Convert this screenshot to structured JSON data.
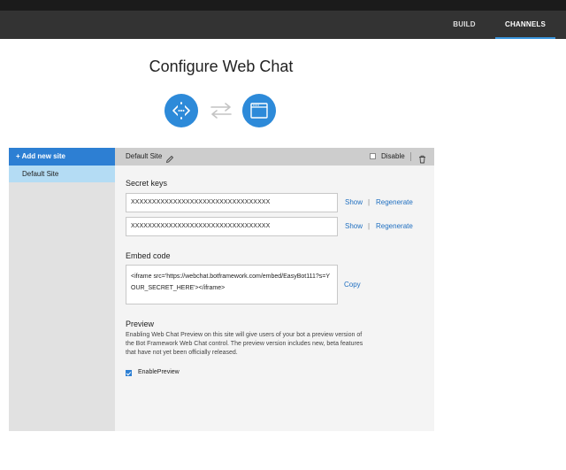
{
  "nav": {
    "build_label": "BUILD",
    "channels_label": "CHANNELS"
  },
  "page": {
    "title": "Configure Web Chat"
  },
  "icons": {
    "left": "code-brackets-icon",
    "middle": "swap-arrows-icon",
    "right": "browser-window-icon"
  },
  "sidebar": {
    "add_label": "+ Add new site",
    "items": [
      {
        "label": "Default Site",
        "selected": true
      }
    ]
  },
  "panel": {
    "site_name": "Default Site",
    "disable_label": "Disable",
    "disable_checked": false,
    "secret_keys_title": "Secret keys",
    "keys": [
      {
        "value": "XXXXXXXXXXXXXXXXXXXXXXXXXXXXXXXXX",
        "show_label": "Show",
        "separator": "|",
        "regenerate_label": "Regenerate"
      },
      {
        "value": "XXXXXXXXXXXXXXXXXXXXXXXXXXXXXXXXX",
        "show_label": "Show",
        "separator": "|",
        "regenerate_label": "Regenerate"
      }
    ],
    "embed_title": "Embed code",
    "embed_code": "<iframe src='https://webchat.botframework.com/embed/EasyBot111?s=YOUR_SECRET_HERE'></iframe>",
    "copy_label": "Copy",
    "preview_title": "Preview",
    "preview_description": "Enabling Web Chat Preview on this site will give users of your bot a preview version of the Bot Framework Web Chat control. The preview version includes new, beta features that have not yet been officially released.",
    "enable_preview_label": "EnablePreview",
    "enable_preview_checked": true
  },
  "colors": {
    "accent": "#2d8ad9",
    "topbar": "#333333",
    "link": "#1f6fc0",
    "sidebar_selected": "#b4dcf4"
  }
}
